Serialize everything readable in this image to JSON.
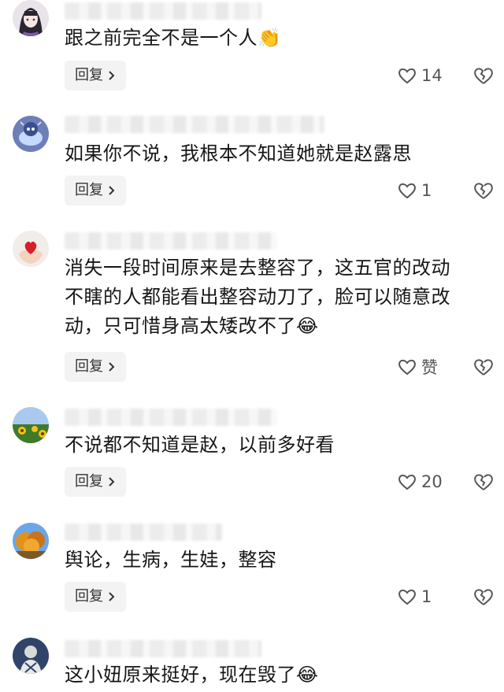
{
  "reply_label": "回复",
  "colors": {
    "text": "#161616",
    "reply_bg": "#f3f3f3",
    "icon": "#555555"
  },
  "comments": [
    {
      "text": "跟之前完全不是一个人",
      "emoji": "👏",
      "likes": "14",
      "avatar": "anime-girl-avatar"
    },
    {
      "text": "如果你不说，我根本不知道她就是赵露思",
      "emoji": "",
      "likes": "1",
      "avatar": "blue-monster-avatar"
    },
    {
      "text_lines": [
        "消失一段时间原来是去整容了，这五官的改动",
        "不瞎的人都能看出整容动刀了，脸可以随意改",
        "动，只可惜身高太矮改不了"
      ],
      "emoji": "😂",
      "likes": "赞",
      "avatar": "heart-hand-avatar"
    },
    {
      "text": "不说都不知道是赵，以前多好看",
      "emoji": "",
      "likes": "20",
      "avatar": "sunflower-avatar"
    },
    {
      "text": "舆论，生病，生娃，整容",
      "emoji": "",
      "likes": "1",
      "avatar": "autumn-tree-avatar"
    },
    {
      "text": "这小妞原来挺好，现在毁了",
      "emoji": "😂",
      "likes": "",
      "avatar": "bw-portrait-avatar"
    }
  ]
}
